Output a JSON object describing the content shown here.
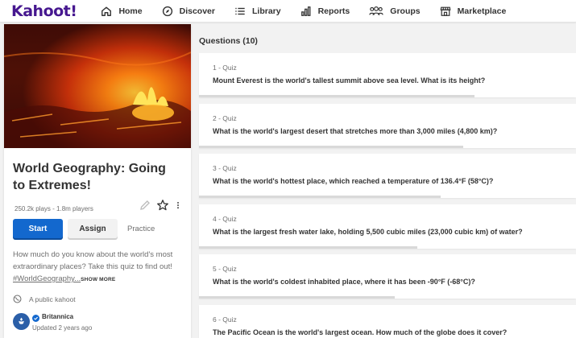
{
  "nav": {
    "logo": "Kahoot!",
    "items": [
      {
        "label": "Home",
        "icon": "home-icon"
      },
      {
        "label": "Discover",
        "icon": "compass-icon"
      },
      {
        "label": "Library",
        "icon": "list-icon"
      },
      {
        "label": "Reports",
        "icon": "bar-chart-icon"
      },
      {
        "label": "Groups",
        "icon": "people-icon"
      },
      {
        "label": "Marketplace",
        "icon": "store-icon"
      }
    ]
  },
  "kahoot": {
    "title": "World Geography: Going to Extremes!",
    "plays": "250.2k plays - 1.8m players",
    "start_label": "Start",
    "assign_label": "Assign",
    "practice_label": "Practice",
    "description": "How much do you know about the world's most extraordinary places? Take this quiz to find out! ",
    "hashtag": "#WorldGeography...",
    "show_more": "SHOW MORE",
    "visibility": "A public kahoot",
    "creator": "Britannica",
    "updated": "Updated 2 years ago"
  },
  "questions_header": "Questions (10)",
  "questions": [
    {
      "num": "1 - Quiz",
      "text": "Mount Everest is the world's tallest summit above sea level. What is its height?",
      "progress": 0.73
    },
    {
      "num": "2 - Quiz",
      "text": "What is the world's largest desert that stretches more than 3,000 miles (4,800 km)?",
      "progress": 0.7
    },
    {
      "num": "3 - Quiz",
      "text": "What is the world's hottest place, which reached a temperature of 136.4°F (58°C)?",
      "progress": 0.64
    },
    {
      "num": "4 - Quiz",
      "text": "What is the largest fresh water lake, holding 5,500 cubic miles (23,000 cubic km) of water?",
      "progress": 0.58
    },
    {
      "num": "5 - Quiz",
      "text": "What is the world's coldest inhabited place, where it has been -90°F (-68°C)?",
      "progress": 0.52
    },
    {
      "num": "6 - Quiz",
      "text": "The Pacific Ocean is the world's largest ocean. How much of the globe does it cover?",
      "progress": 0.46
    }
  ],
  "colors": {
    "brand": "#46178f",
    "start_button": "#1368ce",
    "verified": "#1368ce"
  }
}
